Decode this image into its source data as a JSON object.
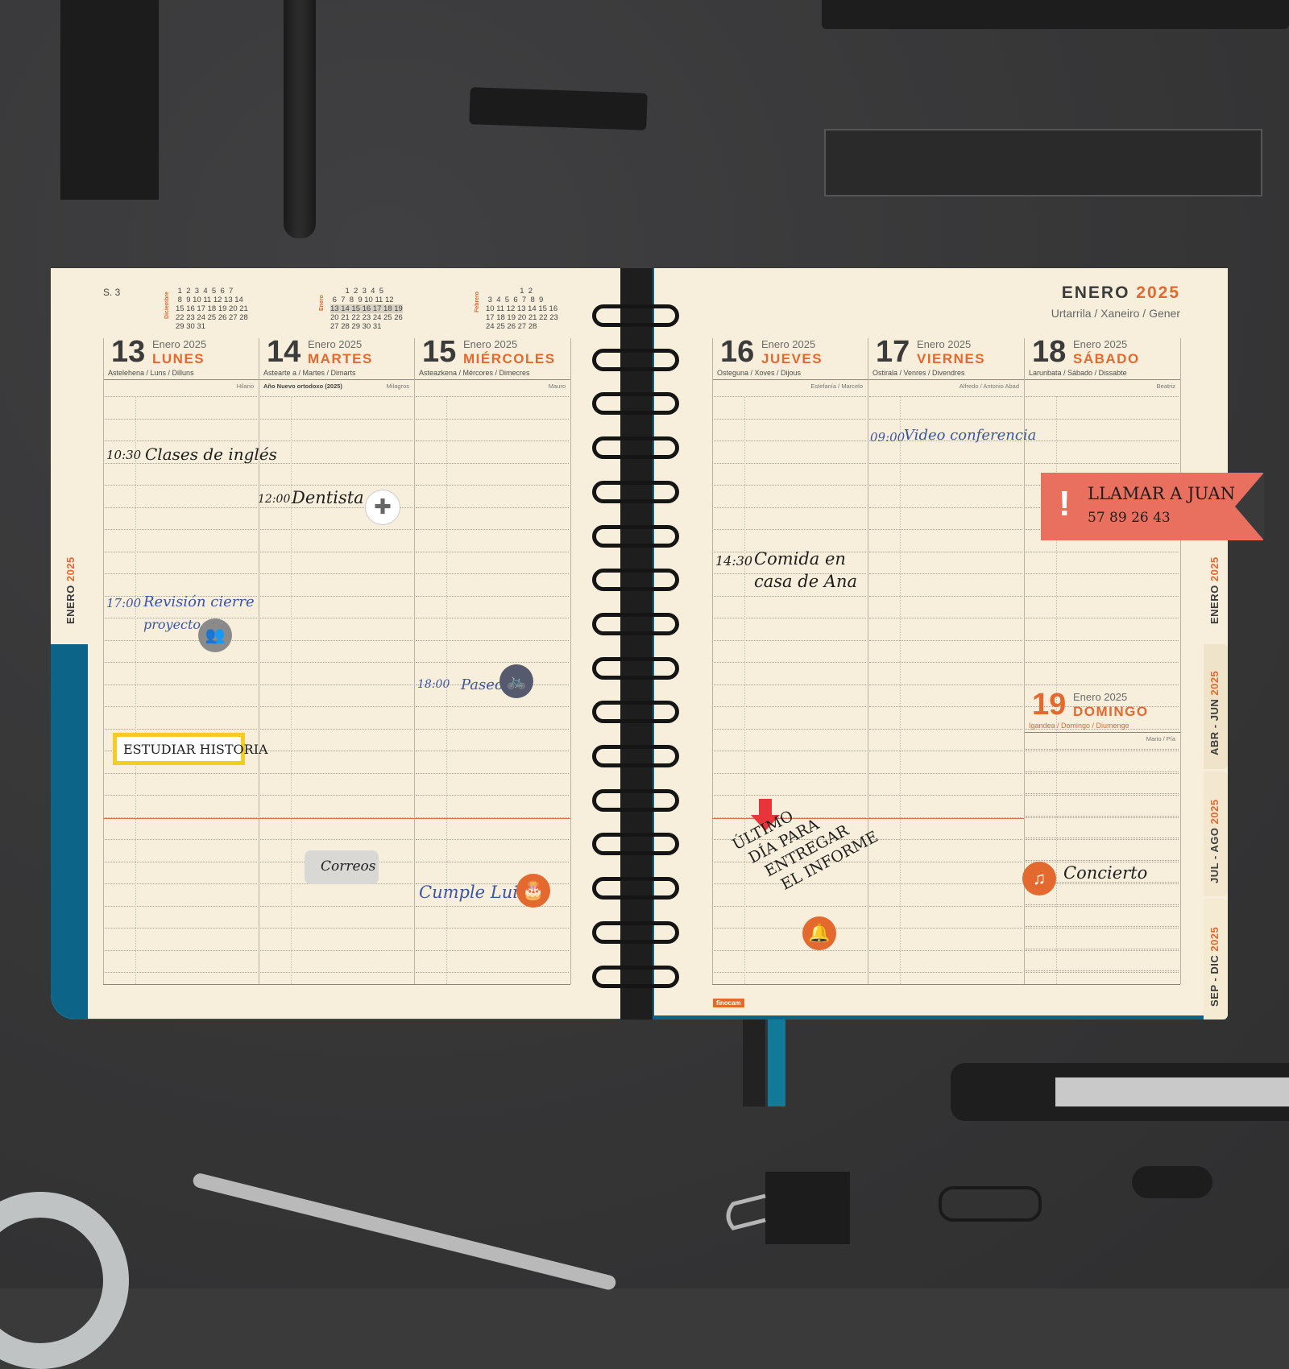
{
  "planner": {
    "week_label": "S. 3",
    "month_title": "ENERO",
    "year": "2025",
    "month_langs": "Urtarrila / Xaneiro / Gener",
    "brand": "finocam",
    "minicals": [
      {
        "label": "Diciembre",
        "rows": [
          " 1  2  3  4  5  6  7",
          " 8  9 10 11 12 13 14",
          "15 16 17 18 19 20 21",
          "22 23 24 25 26 27 28",
          "29 30 31"
        ]
      },
      {
        "label": "Enero",
        "rows": [
          "       1  2  3  4  5",
          " 6  7  8  9 10 11 12",
          "13 14 15 16 17 18 19",
          "20 21 22 23 24 25 26",
          "27 28 29 30 31"
        ]
      },
      {
        "label": "Febrero",
        "rows": [
          "                1  2",
          " 3  4  5  6  7  8  9",
          "10 11 12 13 14 15 16",
          "17 18 19 20 21 22 23",
          "24 25 26 27 28"
        ]
      }
    ],
    "days": [
      {
        "num": "13",
        "month": "Enero 2025",
        "name": "LUNES",
        "langs": "Astelehena / Luns / Dilluns",
        "saint": "Hilario",
        "note": ""
      },
      {
        "num": "14",
        "month": "Enero 2025",
        "name": "MARTES",
        "langs": "Astearte a / Martes / Dimarts",
        "saint": "Milagros",
        "note": "Año Nuevo ortodoxo (2025)"
      },
      {
        "num": "15",
        "month": "Enero 2025",
        "name": "MIÉRCOLES",
        "langs": "Asteazkena / Mércores / Dimecres",
        "saint": "Mauro",
        "note": ""
      },
      {
        "num": "16",
        "month": "Enero 2025",
        "name": "JUEVES",
        "langs": "Osteguna / Xoves / Dijous",
        "saint": "Estefanía / Marcelo",
        "note": ""
      },
      {
        "num": "17",
        "month": "Enero 2025",
        "name": "VIERNES",
        "langs": "Ostirala / Venres / Divendres",
        "saint": "Alfredo / Antonio Abad",
        "note": ""
      },
      {
        "num": "18",
        "month": "Enero 2025",
        "name": "SÁBADO",
        "langs": "Larunbata / Sábado / Dissabte",
        "saint": "Beatriz",
        "note": ""
      },
      {
        "num": "19",
        "month": "Enero 2025",
        "name": "DOMINGO",
        "langs": "Igandea / Domingo / Diumenge",
        "saint": "Mario / Pía",
        "note": ""
      }
    ],
    "side_tabs": [
      {
        "text": "ENERO",
        "year": "2025"
      },
      {
        "text": "ENERO",
        "year": "2025"
      },
      {
        "text": "ABR - JUN",
        "year": "2025"
      },
      {
        "text": "JUL - AGO",
        "year": "2025"
      },
      {
        "text": "SEP - DIC",
        "year": "2025"
      }
    ],
    "notes": {
      "lunes_1": {
        "time": "10:30",
        "text": "Clases de inglés"
      },
      "martes_1": {
        "time": "12:00",
        "text": "Dentista"
      },
      "lunes_2": {
        "time": "17:00",
        "text": "Revisión cierre",
        "text2": "proyecto"
      },
      "miercoles_1": {
        "time": "18:00",
        "text": "Paseo"
      },
      "lunes_3": {
        "text": "ESTUDIAR HISTORIA"
      },
      "martes_2": {
        "text": "Correos"
      },
      "miercoles_2": {
        "text": "Cumple Luis"
      },
      "viernes_1": {
        "time": "09:00",
        "text": "Video conferencia"
      },
      "jueves_1": {
        "time": "14:30",
        "text": "Comida en",
        "text2": "casa de Ana"
      },
      "jueves_2": {
        "lines": [
          "ÚLTIMO",
          "DÍA PARA",
          "ENTREGAR",
          "EL INFORME"
        ]
      },
      "domingo_1": {
        "text": "Concierto"
      },
      "flag": {
        "text": "LLAMAR A JUAN",
        "phone": "57 89 26 43"
      }
    },
    "icons": {
      "dentista": "medical-cross-icon",
      "reunion": "people-group-icon",
      "paseo": "bicycle-icon",
      "cumple": "birthday-cake-icon",
      "informe": "bell-icon",
      "concierto": "music-note-icon",
      "alerta": "exclamation-icon"
    },
    "colors": {
      "accent": "#e3692f",
      "cover": "#0d6489",
      "paper": "#f7efdc",
      "flag": "#e9705f",
      "highlight": "#f4cd1e"
    }
  }
}
